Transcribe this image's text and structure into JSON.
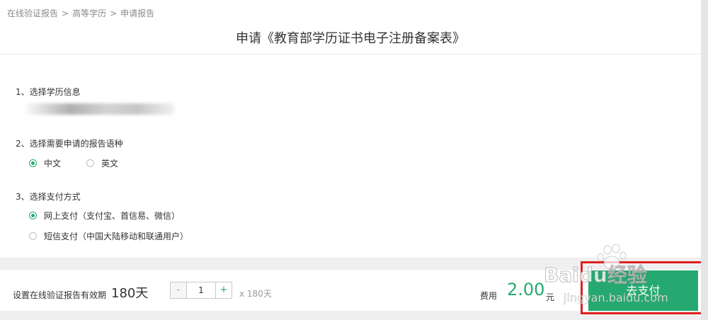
{
  "breadcrumb": [
    "在线验证报告",
    "高等学历",
    "申请报告"
  ],
  "breadcrumb_sep": ">",
  "title": "申请《教育部学历证书电子注册备案表》",
  "step1": {
    "label": "1、选择学历信息"
  },
  "step2": {
    "label": "2、选择需要申请的报告语种",
    "options": [
      {
        "label": "中文",
        "checked": true
      },
      {
        "label": "英文",
        "checked": false
      }
    ]
  },
  "step3": {
    "label": "3、选择支付方式",
    "options": [
      {
        "label": "网上支付（支付宝、首信易、微信）",
        "checked": true
      },
      {
        "label": "短信支付（中国大陆移动和联通用户）",
        "checked": false
      }
    ]
  },
  "bottom": {
    "validity_label": "设置在线验证报告有效期",
    "validity_days": "180天",
    "minus": "-",
    "quantity": "1",
    "plus": "+",
    "multiplier": "x 180天",
    "fee_label": "费用",
    "fee_amount": "2.00",
    "fee_unit": "元",
    "pay_button": "去支付"
  },
  "watermark": {
    "text": "Baidu经验",
    "url": "jingyan.baidu.com"
  },
  "colors": {
    "accent": "#26a970",
    "annotation": "#e02020"
  }
}
